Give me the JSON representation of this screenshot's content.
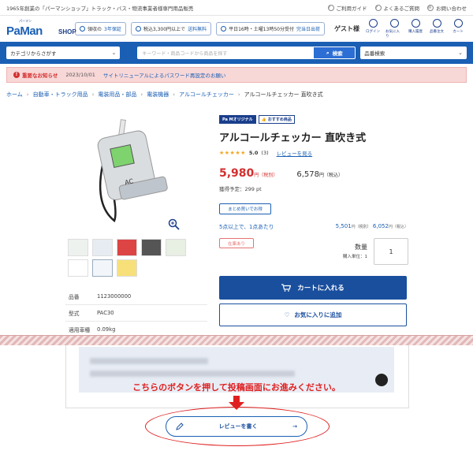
{
  "topbar": {
    "tagline": "1965年創業の「パーマンショップ」トラック・バス・物流事業者様専門用品販売",
    "links": [
      "ご利用ガイド",
      "よくあるご質問",
      "お問い合わせ"
    ]
  },
  "header": {
    "logo_ruby": "パーマン",
    "logo_name": "PaMan",
    "logo_shop": "SHOP",
    "badges": [
      {
        "text": "",
        "highlight": "",
        "pre": "領収の",
        "hl": "3年保証"
      },
      {
        "pre": "税込3,300円以上で",
        "hl": "送料無料"
      },
      {
        "pre": "平日16時・土曜13時50分受付",
        "hl": "完当日出荷"
      }
    ],
    "guest": "ゲスト様",
    "icons": [
      "ログイン",
      "お気に入り",
      "購入履歴",
      "品番注文",
      "カート"
    ]
  },
  "search": {
    "category": "カテゴリからさがす",
    "placeholder": "キーワード・商品コードから商品を探す",
    "button": "検索",
    "partsearch": "品番検索"
  },
  "notice": {
    "title": "重要なお知らせ",
    "date": "2023/10/01",
    "message": "サイトリニューアルによるパスワード再設定のお願い"
  },
  "breadcrumb": [
    "ホーム",
    "自動車・トラック用品",
    "電装用品・部品",
    "電装機器",
    "アルコールチェッカー",
    "アルコールチェッカー 直吹き式"
  ],
  "product": {
    "tag1": "Pa Mオリジナル",
    "tag2": "おすすめ商品",
    "title": "アルコールチェッカー 直吹き式",
    "stars": "★★★★★",
    "score": "5.0",
    "count": "(3)",
    "review_link": "レビューを見る",
    "price": "5,980",
    "price_unit": "円",
    "price_tax": "（税別）",
    "price_incl": "6,578",
    "price_incl_unit": "円",
    "price_incl_tax": "（税込）",
    "points": "獲得予定：299 pt",
    "bulk_button": "まとめ買いでお得",
    "bulk_text": "5点以上で、1点あたり",
    "bulk_price": "5,501",
    "bulk_price_unit": "円",
    "bulk_tax": "（税別）",
    "bulk_price_incl": "6,052",
    "bulk_incl_unit": "円",
    "bulk_incl_tax": "（税込）",
    "stock": "在庫あり",
    "qty_label": "数量",
    "qty_unit": "購入単位：1",
    "qty_value": "1",
    "cart_button": "カートに入れる",
    "fav_button": "お気に入りに追加"
  },
  "specs": [
    {
      "k": "品番",
      "v": "1123000000"
    },
    {
      "k": "型式",
      "v": "PAC30"
    },
    {
      "k": "適用車種",
      "v": "0.09kg"
    }
  ],
  "instruction": "こちらのボタンを押して投稿画面にお進みください。",
  "review_button": "レビューを書く",
  "colors": {
    "primary": "#1a5fb4",
    "accent_red": "#e02020",
    "price_red": "#d32f2f"
  }
}
